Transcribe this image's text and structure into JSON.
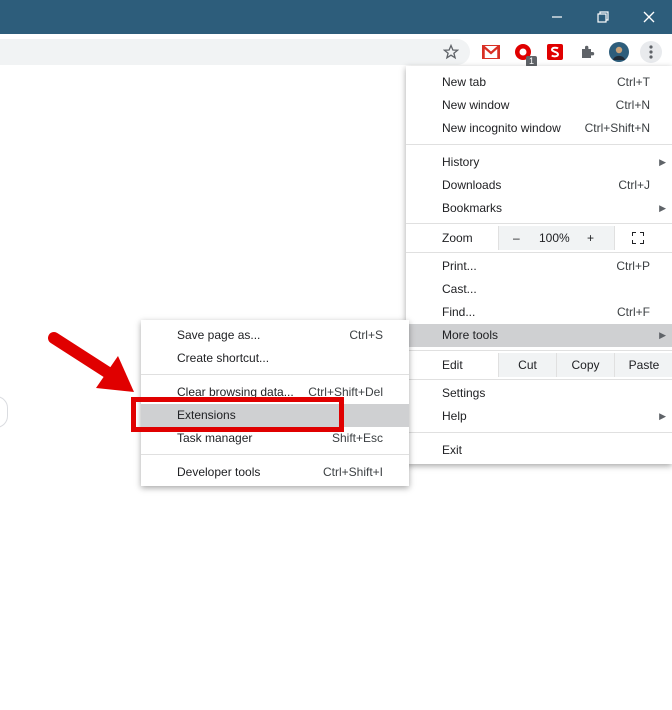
{
  "window": {
    "controls": [
      {
        "name": "minimize",
        "icon": "minimize-icon"
      },
      {
        "name": "restore",
        "icon": "restore-icon"
      },
      {
        "name": "close",
        "icon": "close-icon"
      }
    ],
    "titlebar_color": "#2d5d7b"
  },
  "toolbar": {
    "icons": [
      "star-icon",
      "gmail-icon",
      "extension-red-icon",
      "extension-s-icon",
      "puzzle-icon",
      "avatar",
      "kebab-menu-icon"
    ],
    "badge_count": "1"
  },
  "menu": {
    "items": {
      "new_tab": {
        "label": "New tab",
        "shortcut": "Ctrl+T"
      },
      "new_window": {
        "label": "New window",
        "shortcut": "Ctrl+N"
      },
      "new_incognito": {
        "label": "New incognito window",
        "shortcut": "Ctrl+Shift+N"
      },
      "history": {
        "label": "History"
      },
      "downloads": {
        "label": "Downloads",
        "shortcut": "Ctrl+J"
      },
      "bookmarks": {
        "label": "Bookmarks"
      },
      "print": {
        "label": "Print...",
        "shortcut": "Ctrl+P"
      },
      "cast": {
        "label": "Cast..."
      },
      "find": {
        "label": "Find...",
        "shortcut": "Ctrl+F"
      },
      "more_tools": {
        "label": "More tools"
      },
      "settings": {
        "label": "Settings"
      },
      "help": {
        "label": "Help"
      },
      "exit": {
        "label": "Exit"
      }
    },
    "zoom": {
      "label": "Zoom",
      "minus": "–",
      "value": "100%",
      "plus": "+"
    },
    "edit": {
      "label": "Edit",
      "cut": "Cut",
      "copy": "Copy",
      "paste": "Paste"
    }
  },
  "submenu": {
    "items": {
      "save_page": {
        "label": "Save page as...",
        "shortcut": "Ctrl+S"
      },
      "create_shortcut": {
        "label": "Create shortcut..."
      },
      "clear_browsing": {
        "label": "Clear browsing data...",
        "shortcut": "Ctrl+Shift+Del"
      },
      "extensions": {
        "label": "Extensions"
      },
      "task_manager": {
        "label": "Task manager",
        "shortcut": "Shift+Esc"
      },
      "developer_tools": {
        "label": "Developer tools",
        "shortcut": "Ctrl+Shift+I"
      }
    }
  },
  "colors": {
    "accent_red": "#e00000",
    "highlight": "#cfd0d2"
  }
}
